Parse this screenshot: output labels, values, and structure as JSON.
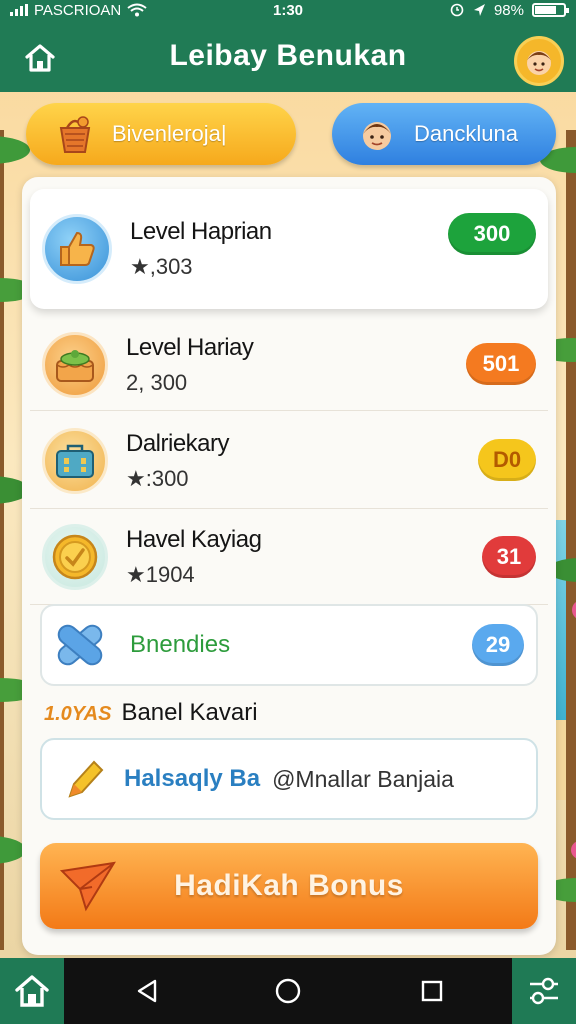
{
  "status_bar": {
    "carrier": "PASCRIOAN",
    "time": "1:30",
    "battery": "98%"
  },
  "header": {
    "title": "Leibay Benukan",
    "home_icon": "home-icon",
    "avatar_icon": "avatar-icon"
  },
  "top_buttons": {
    "left": {
      "label": "Bivenleroja|",
      "icon": "basket-icon"
    },
    "right": {
      "label": "Danckluna",
      "icon": "character-icon"
    }
  },
  "levels": [
    {
      "name": "Level Haprian",
      "score": "★,303",
      "badge": "300",
      "badge_color": "#1da33c",
      "icon": "thumbs-up-icon"
    },
    {
      "name": "Level Hariay",
      "score": "2, 300",
      "badge": "501",
      "badge_color": "#f47a20",
      "icon": "cake-icon"
    },
    {
      "name": "Dalriekary",
      "score": "★:300",
      "badge": "D0",
      "badge_color": "#f5c61c",
      "icon": "briefcase-icon"
    },
    {
      "name": "Havel Kayiag",
      "score": "★1904",
      "badge": "31",
      "badge_color": "#e13b3b",
      "icon": "coin-icon"
    }
  ],
  "bonus_row": {
    "name": "Bnendies",
    "badge": "29",
    "badge_color": "#5aa9ee",
    "icon": "bandage-icon"
  },
  "section": {
    "tag": "1.0YAS",
    "heading": "Banel Kavari"
  },
  "input_row": {
    "prefix": "Halsaqly Ba",
    "value": "@Mnallar Banjaia",
    "icon": "pencil-icon"
  },
  "cta": {
    "label": "HadiKah Bonus",
    "icon": "paper-plane-icon"
  },
  "nav": {
    "back": "back-icon",
    "home": "circle-home-icon",
    "recents": "square-recents-icon"
  }
}
